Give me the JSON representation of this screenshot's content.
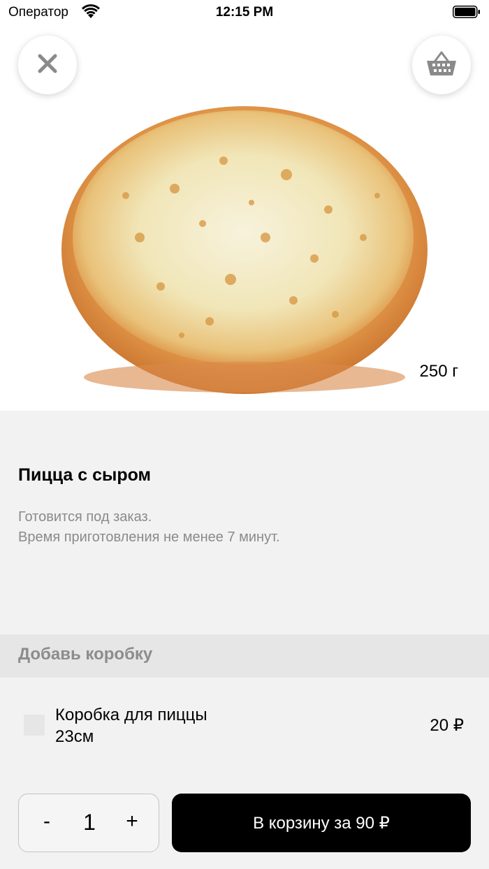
{
  "status_bar": {
    "carrier": "Оператор",
    "time": "12:15 PM"
  },
  "product": {
    "weight": "250 г",
    "title": "Пицца с сыром",
    "description_line1": "Готовится под заказ.",
    "description_line2": "Время приготовления не менее 7 минут."
  },
  "box_section": {
    "header": "Добавь коробку",
    "option": {
      "label": "Коробка для пиццы 23см",
      "price": "20 ₽",
      "checked": false
    }
  },
  "bottom": {
    "minus": "-",
    "quantity": "1",
    "plus": "+",
    "add_button": "В корзину за 90 ₽"
  },
  "icons": {
    "close": "close-icon",
    "cart": "basket-icon",
    "wifi": "wifi-icon",
    "battery": "battery-icon"
  },
  "colors": {
    "primary_button": "#000000",
    "background": "#f2f2f2",
    "section_header_bg": "#e6e6e6",
    "muted_text": "#8a8a8a"
  }
}
